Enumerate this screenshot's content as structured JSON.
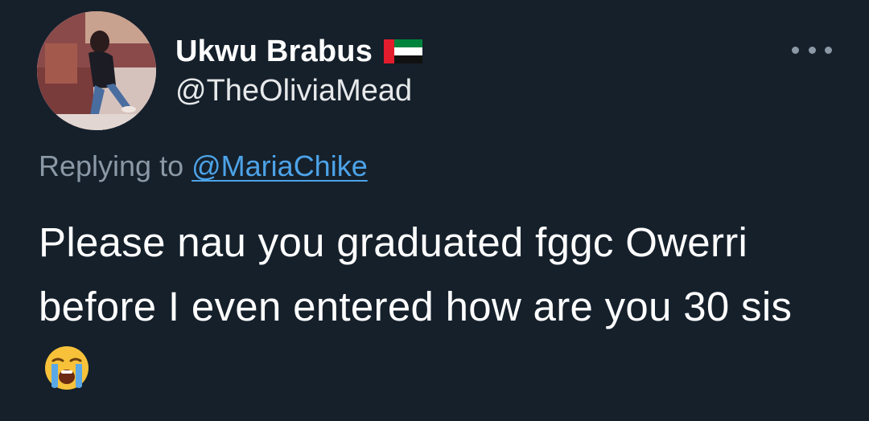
{
  "tweet": {
    "display_name": "Ukwu Brabus",
    "flag_icon": "uae-flag-icon",
    "handle": "@TheOliviaMead",
    "more_icon": "more-options-icon",
    "replying_prefix": "Replying to",
    "replying_to": "@MariaChike",
    "text": "Please nau you graduated fggc Owerri before I even entered how are you 30 sis",
    "emoji_icon": "loudly-crying-face-icon"
  },
  "colors": {
    "background": "#15202b",
    "text_primary": "#ffffff",
    "text_secondary": "#8b98a5",
    "link": "#4da3e8"
  }
}
